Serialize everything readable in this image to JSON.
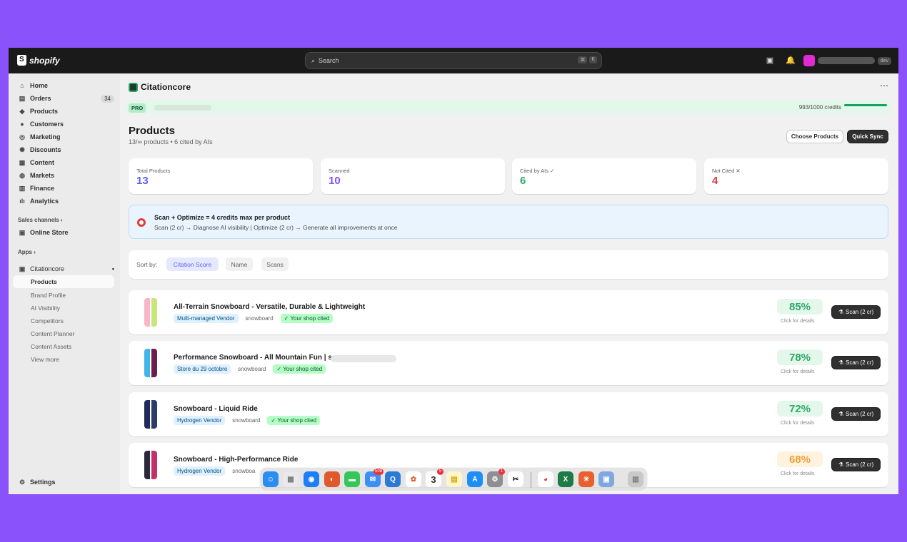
{
  "topbar": {
    "logo": "shopify",
    "search_placeholder": "Search",
    "shortcut_keys": [
      "⌘",
      "K"
    ],
    "user_tag": "dev"
  },
  "sidebar": {
    "items": [
      {
        "label": "Home",
        "icon": "home-icon"
      },
      {
        "label": "Orders",
        "icon": "orders-icon",
        "badge": "34"
      },
      {
        "label": "Products",
        "icon": "tag-icon"
      },
      {
        "label": "Customers",
        "icon": "person-icon"
      },
      {
        "label": "Marketing",
        "icon": "target-icon"
      },
      {
        "label": "Discounts",
        "icon": "discount-icon"
      },
      {
        "label": "Content",
        "icon": "content-icon"
      },
      {
        "label": "Markets",
        "icon": "globe-icon"
      },
      {
        "label": "Finance",
        "icon": "bank-icon"
      },
      {
        "label": "Analytics",
        "icon": "chart-icon"
      }
    ],
    "sales_channels_label": "Sales channels",
    "online_store": "Online Store",
    "apps_label": "Apps",
    "app_name": "Citationcore",
    "app_subitems": [
      "Products",
      "Brand Profile",
      "AI Visibility",
      "Competitors",
      "Content Planner",
      "Content Assets",
      "View more"
    ],
    "settings": "Settings"
  },
  "header": {
    "app_title": "Citationcore",
    "plan_badge": "PRO",
    "credits_text": "993/1000 credits",
    "credits_fraction": 0.993
  },
  "page": {
    "title": "Products",
    "subtitle": "13/∞ products • 6 cited by AIs",
    "choose_button": "Choose Products",
    "sync_button": "Quick Sync"
  },
  "stats": [
    {
      "label": "Total Products",
      "value": "13",
      "color": "#5b5ff5"
    },
    {
      "label": "Scanned",
      "value": "10",
      "color": "#8a52fb"
    },
    {
      "label": "Cited by AIs ✓",
      "value": "6",
      "color": "#2fa86b"
    },
    {
      "label": "Not Cited ✕",
      "value": "4",
      "color": "#e03a3a"
    }
  ],
  "info": {
    "title": "Scan + Optimize = 4 credits max per product",
    "text": "Scan (2 cr) → Diagnose AI visibility | Optimize (2 cr) → Generate all improvements at once"
  },
  "sort": {
    "label": "Sort by:",
    "options": [
      "Citation Score",
      "Name",
      "Scans"
    ],
    "selected": "Citation Score"
  },
  "products": [
    {
      "name": "All-Terrain Snowboard - Versatile, Durable & Lightweight",
      "vendor": "Multi-managed Vendor",
      "type": "snowboard",
      "cited": "✓ Your shop cited",
      "score": "85%",
      "details": "Click for details",
      "scan": "Scan (2 cr)"
    },
    {
      "name": "Performance Snowboard - All Mountain Fun | s",
      "vendor": "Store du 29 octobre",
      "type": "snowboard",
      "cited": "✓ Your shop cited",
      "score": "78%",
      "details": "Click for details",
      "scan": "Scan (2 cr)"
    },
    {
      "name": "Snowboard - Liquid Ride",
      "vendor": "Hydrogen Vendor",
      "type": "snowboard",
      "cited": "✓ Your shop cited",
      "score": "72%",
      "details": "Click for details",
      "scan": "Scan (2 cr)"
    },
    {
      "name": "Snowboard - High-Performance Ride",
      "vendor": "Hydrogen Vendor",
      "type": "snowboa",
      "cited": "",
      "score": "68%",
      "details": "Click for details",
      "scan": "Scan (2 cr)"
    }
  ],
  "dock": {
    "mail_badge": "508",
    "calendar_day": "3",
    "calendar_badge": "5",
    "settings_badge": "1"
  }
}
